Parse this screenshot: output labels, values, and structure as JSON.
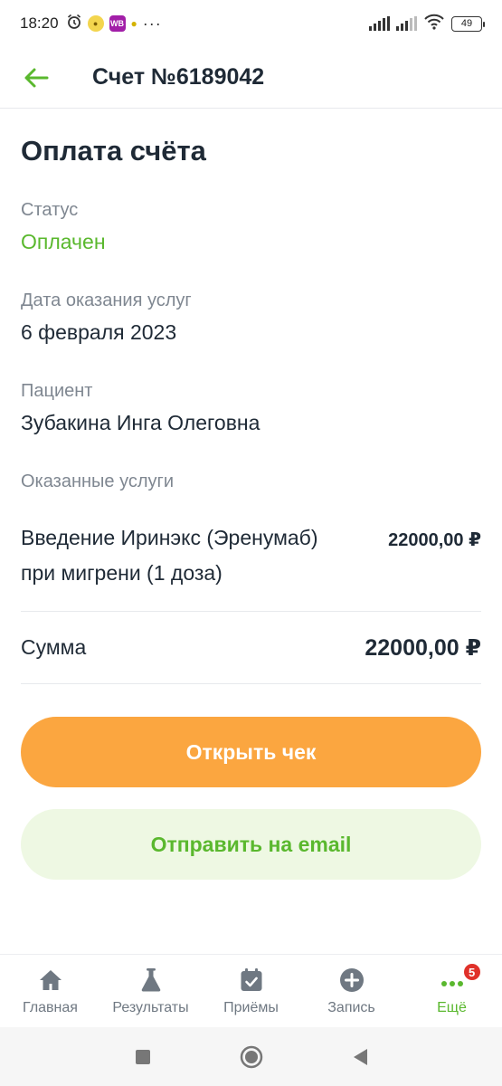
{
  "status_bar": {
    "time": "18:20",
    "wb_label": "WB",
    "battery": "49"
  },
  "header": {
    "title": "Счет №6189042"
  },
  "invoice": {
    "title": "Оплата счёта",
    "status_label": "Статус",
    "status_value": "Оплачен",
    "date_label": "Дата оказания услуг",
    "date_value": "6 февраля 2023",
    "patient_label": "Пациент",
    "patient_value": "Зубакина Инга Олеговна",
    "services_label": "Оказанные услуги",
    "services": [
      {
        "name": "Введение Иринэкс (Эренумаб)  при мигрени (1 доза)",
        "price": "22000,00 ₽"
      }
    ],
    "sum_label": "Сумма",
    "sum_value": "22000,00 ₽"
  },
  "actions": {
    "open_receipt": "Открыть чек",
    "send_email": "Отправить на email"
  },
  "bottom_nav": {
    "items": [
      {
        "label": "Главная",
        "icon": "home-icon"
      },
      {
        "label": "Результаты",
        "icon": "flask-icon"
      },
      {
        "label": "Приёмы",
        "icon": "calendar-icon"
      },
      {
        "label": "Запись",
        "icon": "plus-circle-icon"
      },
      {
        "label": "Ещё",
        "icon": "more-dots-icon",
        "active": true,
        "badge": "5"
      }
    ]
  },
  "colors": {
    "accent_green": "#5ab82e",
    "primary_orange": "#fba640",
    "secondary_green_bg": "#eef8e3",
    "text_dark": "#1f2a36",
    "text_muted": "#7f8791",
    "badge_red": "#e0312a"
  }
}
